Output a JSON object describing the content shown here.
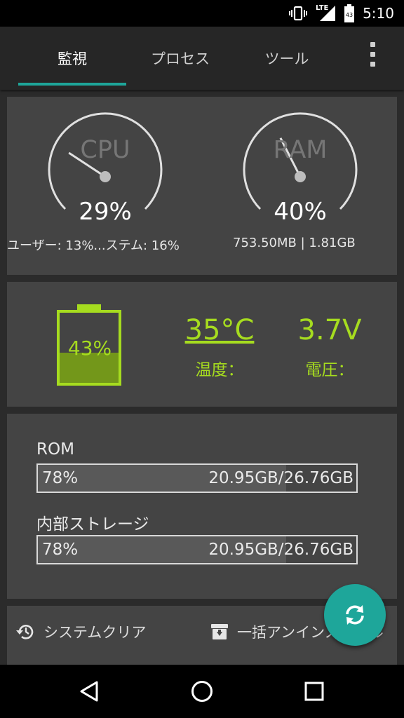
{
  "status_bar": {
    "network": "LTE",
    "battery_level": "43",
    "time": "5:10"
  },
  "tabs": [
    {
      "label": "監視",
      "active": true
    },
    {
      "label": "プロセス",
      "active": false
    },
    {
      "label": "ツール",
      "active": false
    }
  ],
  "cpu": {
    "label": "CPU",
    "percent": "29%",
    "percent_value": 29,
    "detail": "ユーザー: 13%...ステム: 16%"
  },
  "ram": {
    "label": "RAM",
    "percent": "40%",
    "percent_value": 40,
    "detail": "753.50MB | 1.81GB"
  },
  "battery": {
    "percent": "43%",
    "level": 0.43,
    "temperature": "35°C",
    "temperature_label": "温度：",
    "voltage": "3.7V",
    "voltage_label": "電圧：",
    "accent_color": "#a6dc1f"
  },
  "storage": [
    {
      "label": "ROM",
      "percent": "78%",
      "fraction": 0.78,
      "value": "20.95GB/26.76GB"
    },
    {
      "label": "内部ストレージ",
      "percent": "78%",
      "fraction": 0.78,
      "value": "20.95GB/26.76GB"
    }
  ],
  "bottom_actions": {
    "system_clear": "システムクリア",
    "bulk_uninstall": "一括アンインストール"
  },
  "colors": {
    "accent": "#1ea69a",
    "card": "#444444",
    "background": "#2b2b2b"
  }
}
